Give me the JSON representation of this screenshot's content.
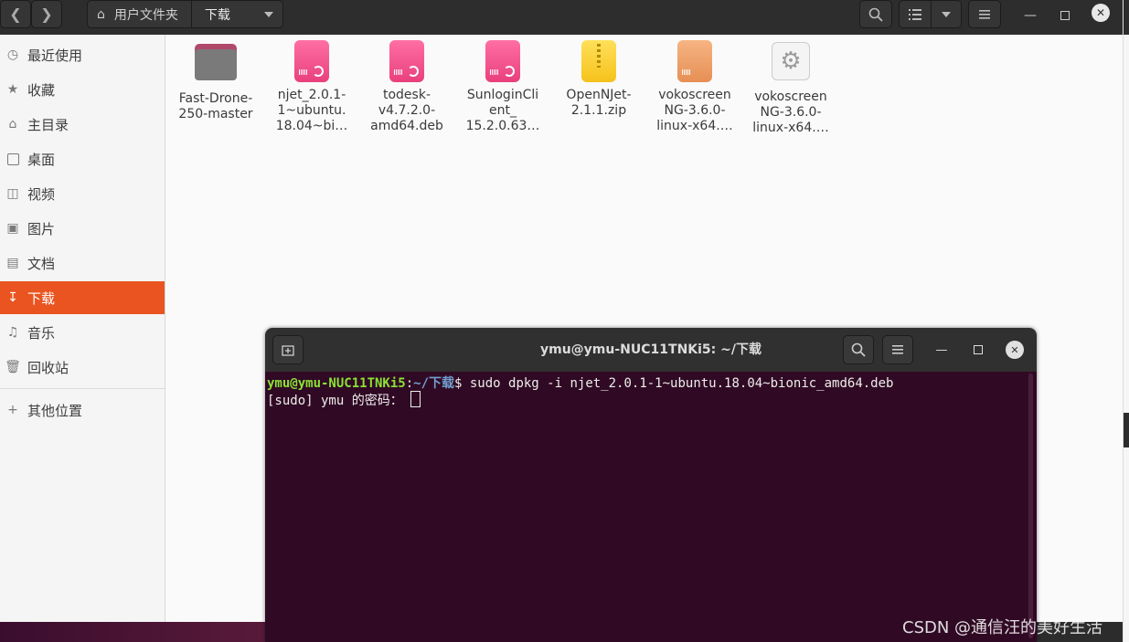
{
  "file_manager": {
    "path_home": "用户文件夹",
    "path_current": "下载",
    "sidebar": [
      {
        "label": "最近使用",
        "icon": "clock-icon"
      },
      {
        "label": "收藏",
        "icon": "star-icon"
      },
      {
        "label": "主目录",
        "icon": "home-icon"
      },
      {
        "label": "桌面",
        "icon": "desktop-icon"
      },
      {
        "label": "视频",
        "icon": "film-icon"
      },
      {
        "label": "图片",
        "icon": "picture-icon"
      },
      {
        "label": "文档",
        "icon": "document-icon"
      },
      {
        "label": "下载",
        "icon": "download-icon",
        "active": true
      },
      {
        "label": "音乐",
        "icon": "music-icon"
      },
      {
        "label": "回收站",
        "icon": "trash-icon"
      }
    ],
    "other_locations": "其他位置",
    "files": [
      {
        "name": "Fast-Drone-250-master",
        "l1": "Fast-Drone-",
        "l2": "250-master",
        "l3": "",
        "type": "folder"
      },
      {
        "name": "njet_2.0.1-1~ubuntu.18.04~bi…",
        "l1": "njet_2.0.1-",
        "l2": "1~ubuntu.",
        "l3": "18.04~bi…",
        "type": "deb"
      },
      {
        "name": "todesk-v4.7.2.0-amd64.deb",
        "l1": "todesk-",
        "l2": "v4.7.2.0-",
        "l3": "amd64.deb",
        "type": "deb"
      },
      {
        "name": "SunloginClient_15.2.0.63…",
        "l1": "SunloginCli",
        "l2": "ent_",
        "l3": "15.2.0.63…",
        "type": "deb"
      },
      {
        "name": "OpenNJet-2.1.1.zip",
        "l1": "OpenNJet-",
        "l2": "2.1.1.zip",
        "l3": "",
        "type": "zip"
      },
      {
        "name": "vokoscreenNG-3.6.0-linux-x64.…",
        "l1": "vokoscreen",
        "l2": "NG-3.6.0-",
        "l3": "linux-x64.…",
        "type": "archive"
      },
      {
        "name": "vokoscreenNG-3.6.0-linux-x64.…",
        "l1": "vokoscreen",
        "l2": "NG-3.6.0-",
        "l3": "linux-x64.…",
        "type": "executable"
      }
    ]
  },
  "terminal": {
    "title": "ymu@ymu-NUC11TNKi5: ~/下载",
    "prompt_user": "ymu@ymu-NUC11TNKi5",
    "prompt_sep": ":",
    "prompt_path": "~/下载",
    "prompt_dollar": "$",
    "command": " sudo dpkg -i njet_2.0.1-1~ubuntu.18.04~bionic_amd64.deb",
    "line2": "[sudo] ymu 的密码： "
  },
  "watermark": "CSDN @通信汪的美好生活"
}
